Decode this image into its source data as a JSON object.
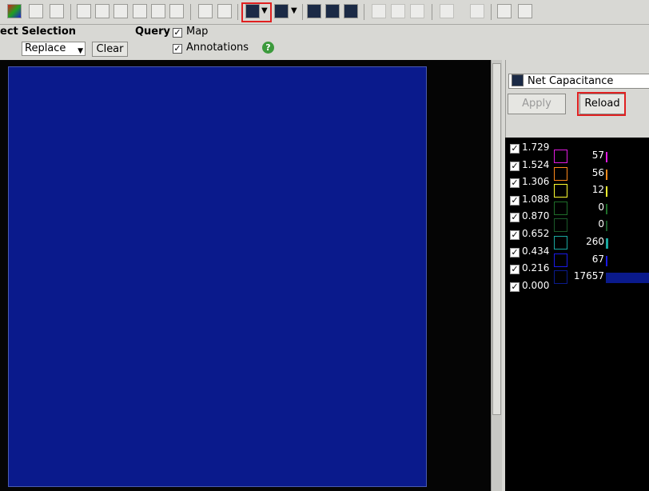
{
  "toolbar": {
    "icons": [
      "color-map-icon",
      "zoom-fit-icon",
      "zoom-2-icon",
      "zoom-3-icon",
      "zoom-4-icon",
      "zoom-5-icon",
      "zoom-in-icon",
      "zoom-out-icon",
      "heatmap-select-icon",
      "net-view-icon",
      "layer-grid-icon",
      "layer-color-icon",
      "layer-view-icon",
      "move-down-icon",
      "move-up-icon",
      "move-top-icon",
      "undo-icon",
      "redo-icon",
      "waveform-icon",
      "tool-clear-icon"
    ]
  },
  "options": {
    "select_partial": "ect",
    "selection_label": "Selection",
    "selection_value": "Replace",
    "clear_label": "Clear",
    "query_label": "Query",
    "map_label": "Map",
    "annotations_label": "Annotations",
    "map_checked": true,
    "annotations_checked": true
  },
  "panel": {
    "dropdown_value": "Net Capacitance",
    "apply_label": "Apply",
    "reload_label": "Reload"
  },
  "legend": [
    {
      "value": "1.729",
      "count": "57",
      "color": "#e21ae2",
      "bar": 0.02
    },
    {
      "value": "1.524",
      "count": "56",
      "color": "#ff8a1a",
      "bar": 0.02
    },
    {
      "value": "1.306",
      "count": "12",
      "color": "#ffff30",
      "bar": 0.01
    },
    {
      "value": "1.088",
      "count": "0",
      "color": "#1e6e2a",
      "bar": 0.01
    },
    {
      "value": "0.870",
      "count": "0",
      "color": "#1a5a2a",
      "bar": 0.01
    },
    {
      "value": "0.652",
      "count": "260",
      "color": "#1aa8a0",
      "bar": 0.05
    },
    {
      "value": "0.434",
      "count": "67",
      "color": "#1a1ae8",
      "bar": 0.02
    },
    {
      "value": "0.216",
      "count": "17657",
      "color": "#0a1a8c",
      "bar": 1.0
    },
    {
      "value": "0.000",
      "count": "",
      "color": "#1a1a50",
      "bar": 0.0
    }
  ]
}
